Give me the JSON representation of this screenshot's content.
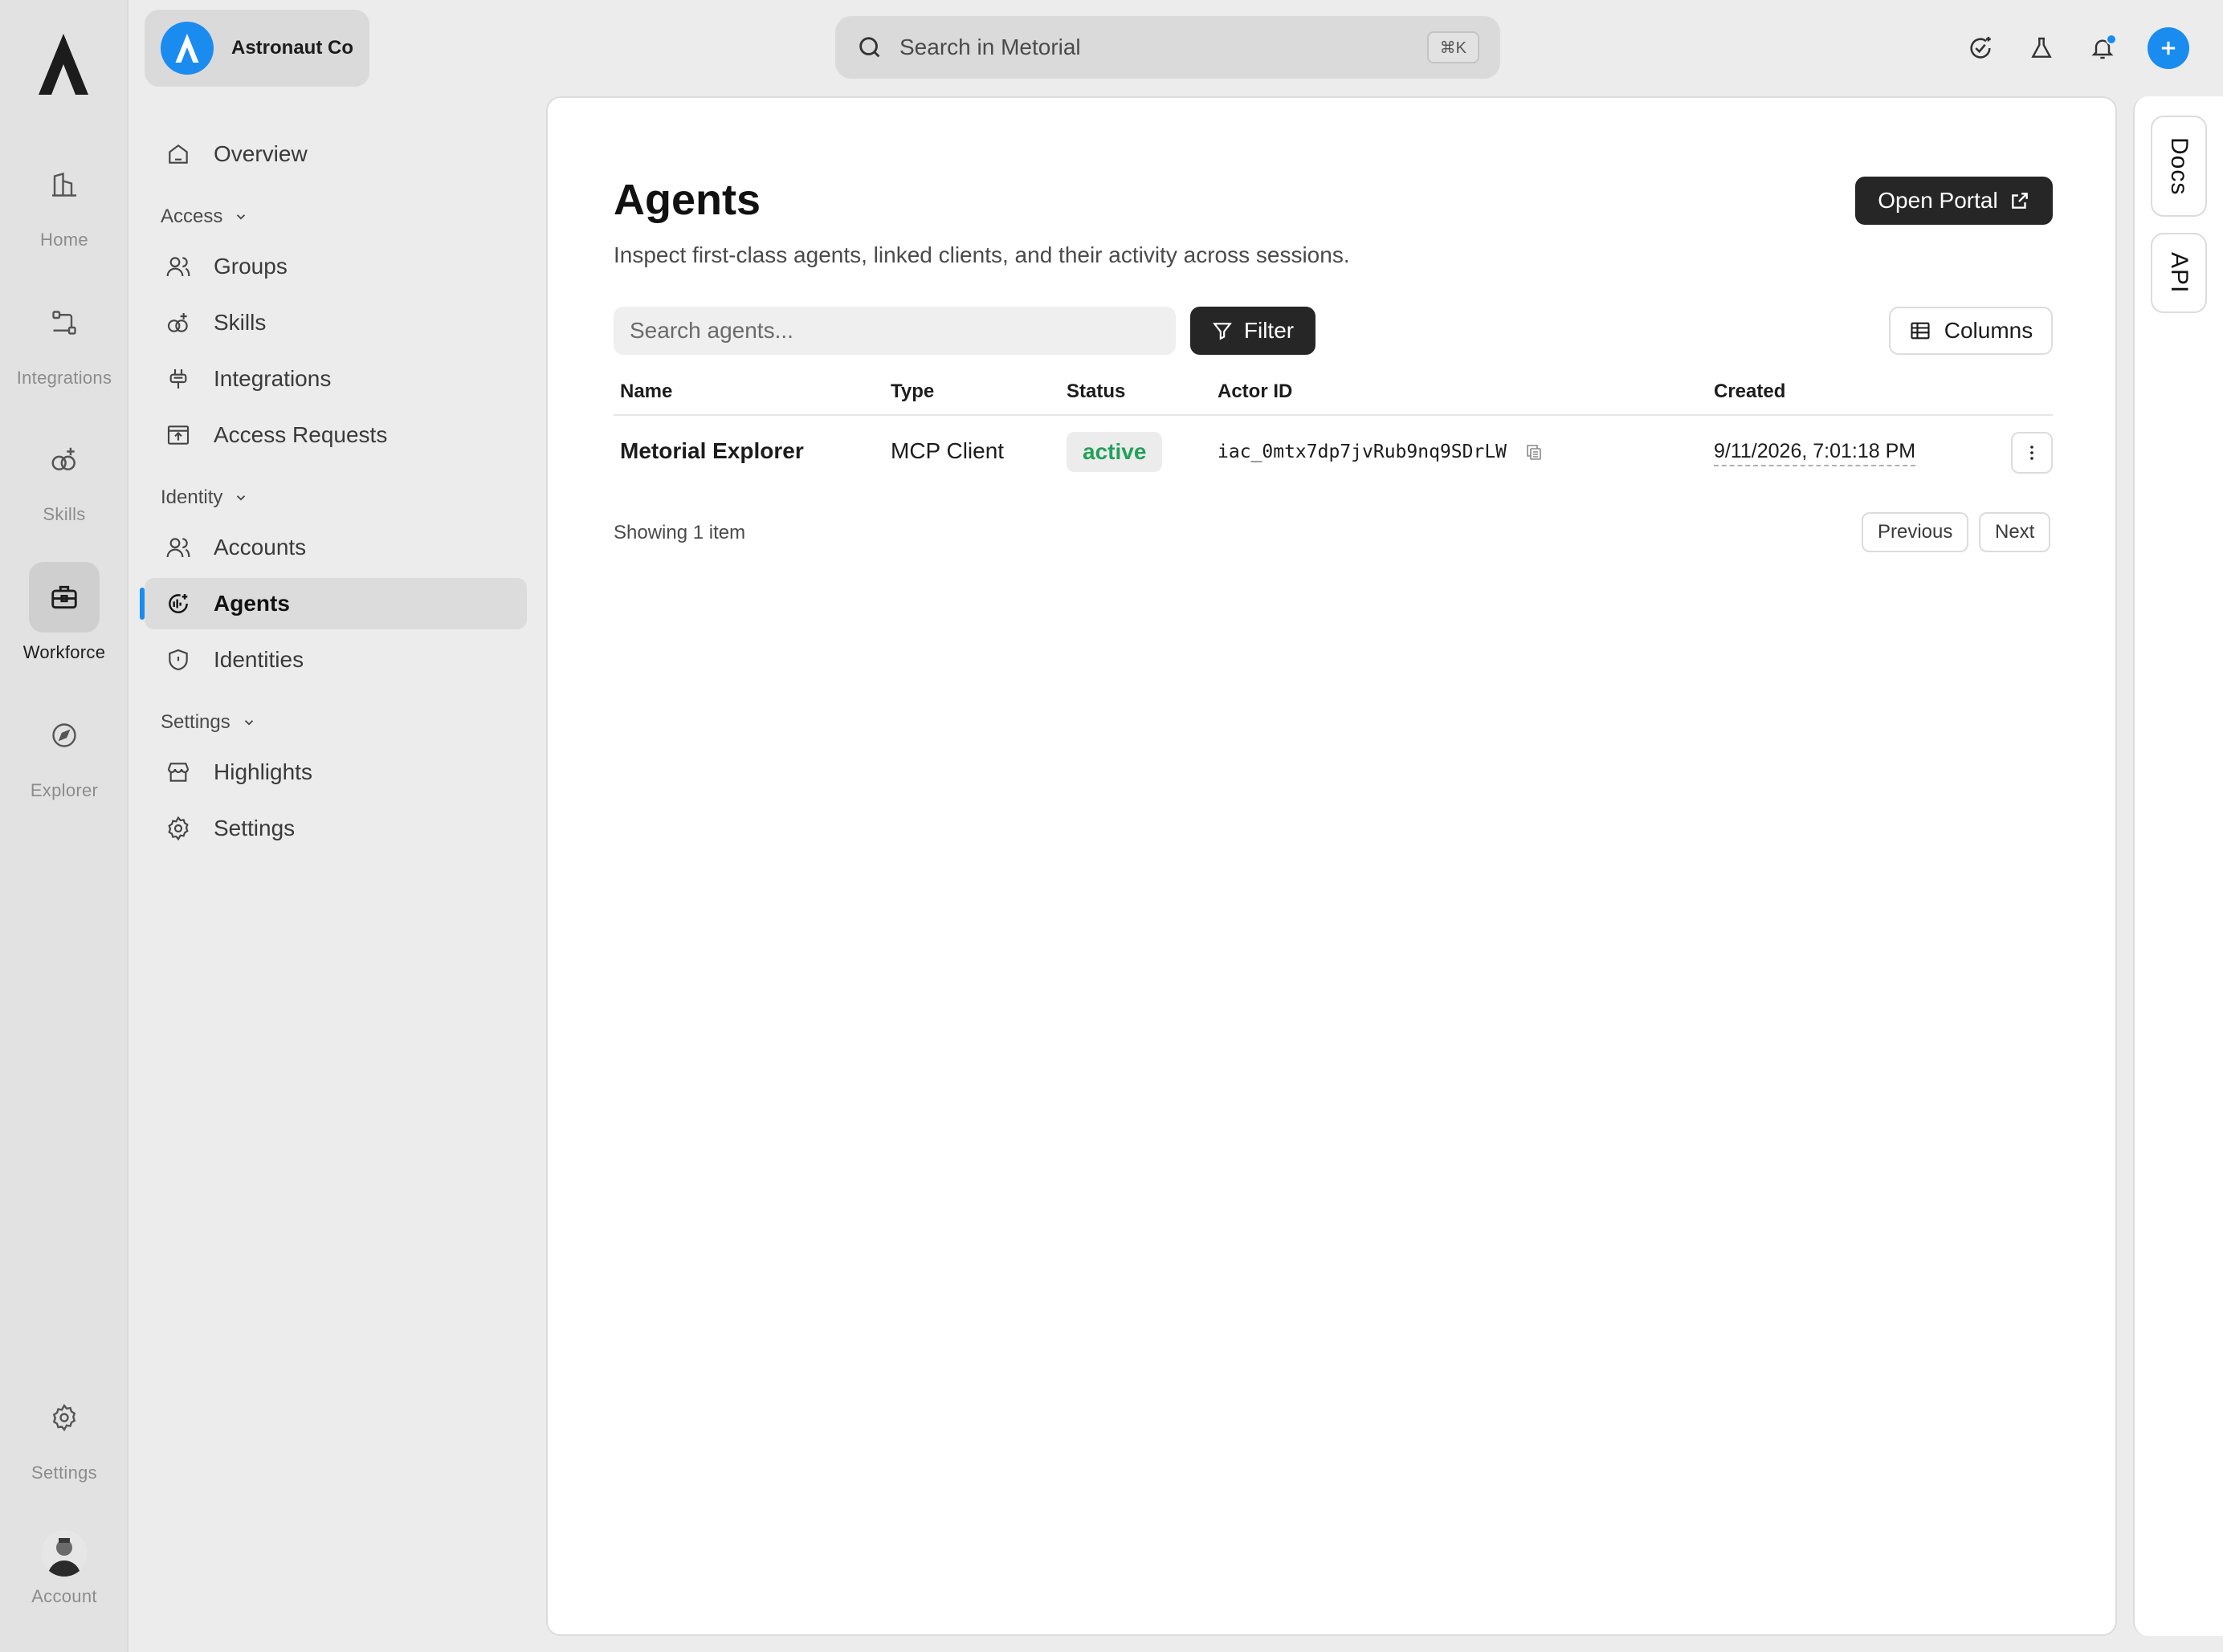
{
  "rail": {
    "items": [
      {
        "label": "Home",
        "icon": "building-icon"
      },
      {
        "label": "Integrations",
        "icon": "workflow-icon"
      },
      {
        "label": "Skills",
        "icon": "skills-icon"
      },
      {
        "label": "Workforce",
        "icon": "briefcase-icon",
        "active": true
      },
      {
        "label": "Explorer",
        "icon": "compass-icon"
      }
    ],
    "settings_label": "Settings",
    "account_label": "Account"
  },
  "org": {
    "name": "Astronaut Co"
  },
  "nav": {
    "overview": "Overview",
    "access_section": "Access",
    "groups": "Groups",
    "skills": "Skills",
    "integrations": "Integrations",
    "access_requests": "Access Requests",
    "identity_section": "Identity",
    "accounts": "Accounts",
    "agents": "Agents",
    "identities": "Identities",
    "settings_section": "Settings",
    "highlights": "Highlights",
    "settings": "Settings"
  },
  "search": {
    "placeholder": "Search in Metorial",
    "shortcut": "⌘K"
  },
  "page": {
    "title": "Agents",
    "subtitle": "Inspect first-class agents, linked clients, and their activity across sessions.",
    "open_portal": "Open Portal",
    "search_placeholder": "Search agents...",
    "filter": "Filter",
    "columns": "Columns"
  },
  "table": {
    "headers": {
      "name": "Name",
      "type": "Type",
      "status": "Status",
      "actor_id": "Actor ID",
      "created": "Created"
    },
    "rows": [
      {
        "name": "Metorial Explorer",
        "type": "MCP Client",
        "status": "active",
        "actor_id": "iac_0mtx7dp7jvRub9nq9SDrLW",
        "created": "9/11/2026, 7:01:18 PM"
      }
    ]
  },
  "footer": {
    "showing": "Showing 1 item",
    "previous": "Previous",
    "next": "Next"
  },
  "right_rail": {
    "docs": "Docs",
    "api": "API"
  },
  "colors": {
    "accent": "#1a8cf0",
    "status_active": "#24a05a",
    "dark_button": "#262626"
  }
}
